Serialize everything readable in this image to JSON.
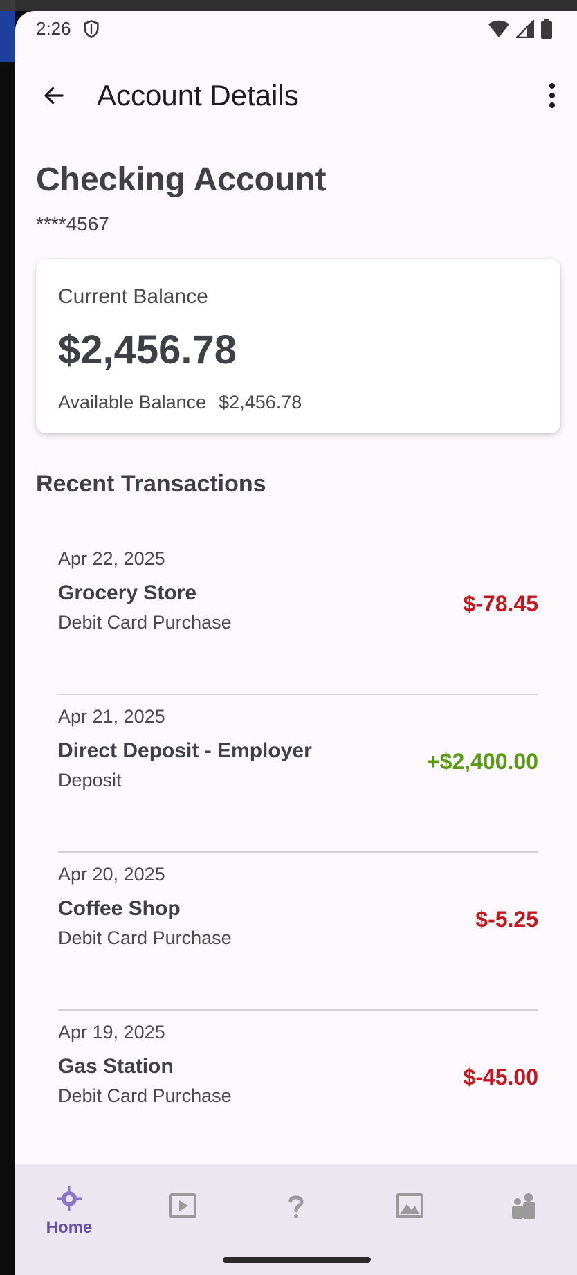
{
  "status_bar": {
    "time": "2:26"
  },
  "app_bar": {
    "title": "Account Details"
  },
  "account": {
    "name": "Checking Account",
    "number": "****4567"
  },
  "balance": {
    "label": "Current Balance",
    "amount": "$2,456.78",
    "available_label": "Available Balance",
    "available_amount": "$2,456.78"
  },
  "transactions_section": {
    "title": "Recent Transactions",
    "items": [
      {
        "date": "Apr 22, 2025",
        "merchant": "Grocery Store",
        "type": "Debit Card Purchase",
        "amount": "$-78.45",
        "color": "#c4161c"
      },
      {
        "date": "Apr 21, 2025",
        "merchant": "Direct Deposit - Employer",
        "type": "Deposit",
        "amount": "+$2,400.00",
        "color": "#5a9a12"
      },
      {
        "date": "Apr 20, 2025",
        "merchant": "Coffee Shop",
        "type": "Debit Card Purchase",
        "amount": "$-5.25",
        "color": "#c4161c"
      },
      {
        "date": "Apr 19, 2025",
        "merchant": "Gas Station",
        "type": "Debit Card Purchase",
        "amount": "$-45.00",
        "color": "#c4161c"
      }
    ]
  },
  "bottom_nav": {
    "home_label": "Home",
    "items": [
      {
        "icon": "home-crosshair-icon",
        "label": "Home",
        "active": true
      },
      {
        "icon": "video-play-icon"
      },
      {
        "icon": "help-question-icon"
      },
      {
        "icon": "image-icon"
      },
      {
        "icon": "people-icon"
      }
    ]
  },
  "colors": {
    "accent": "#6750a4",
    "debit": "#c4161c",
    "credit": "#5a9a12"
  }
}
